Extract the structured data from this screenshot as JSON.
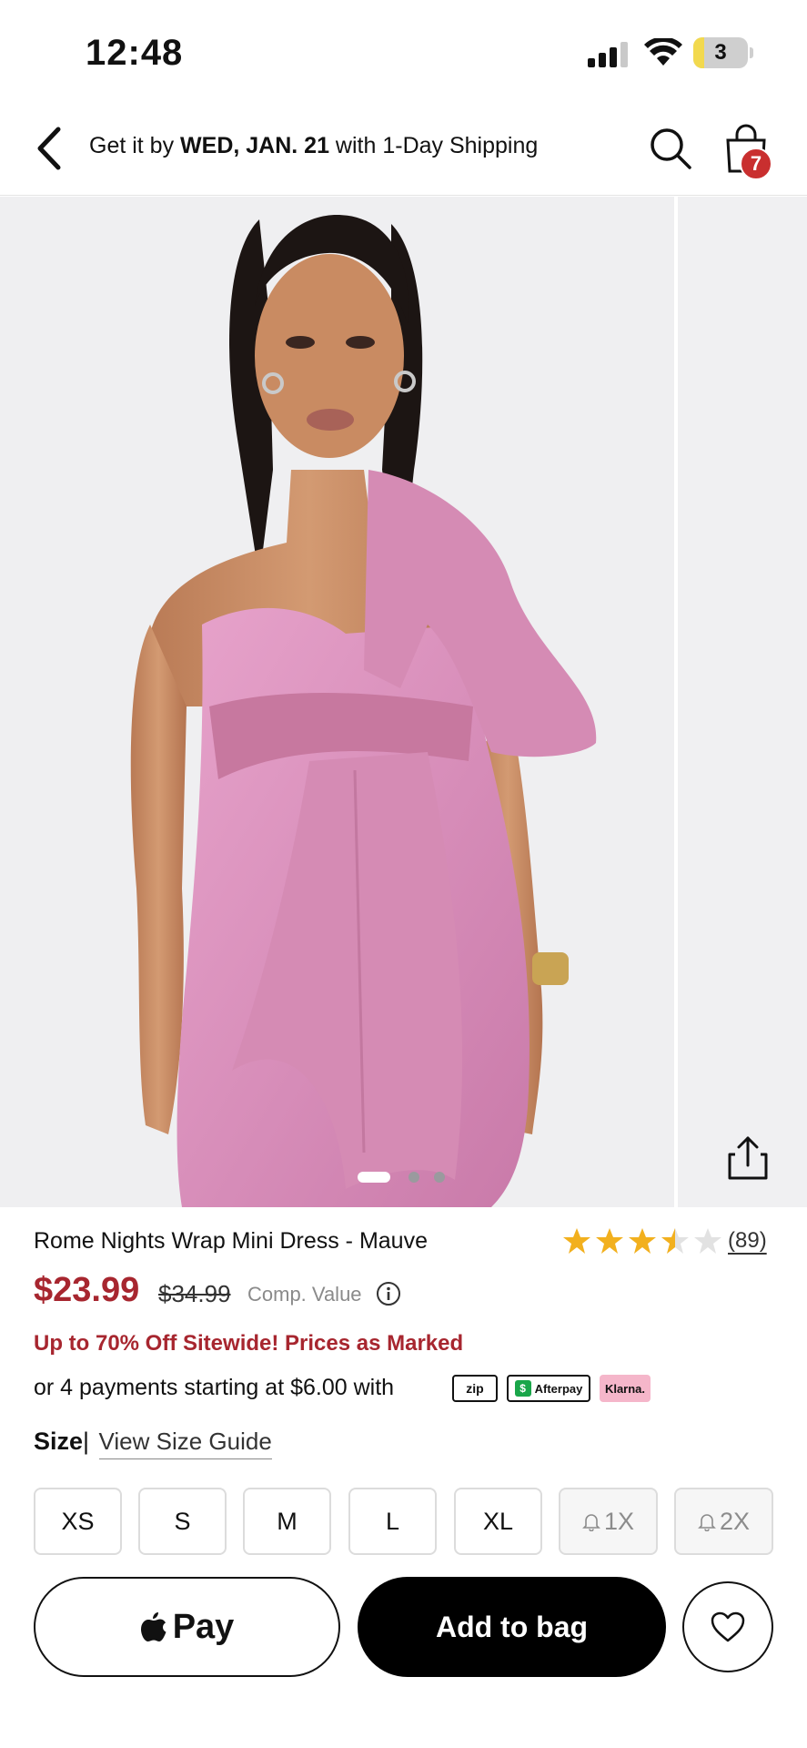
{
  "status_bar": {
    "time": "12:48",
    "battery_level": "3",
    "icons": [
      "cellular-signal-icon",
      "wifi-icon",
      "battery-icon"
    ]
  },
  "header": {
    "shipping_prefix": "Get it by ",
    "shipping_date": "WED, JAN. 21",
    "shipping_suffix": " with 1-Day Shipping",
    "cart_count": "7",
    "icons": [
      "back-arrow-icon",
      "search-icon",
      "shopping-bag-icon"
    ]
  },
  "gallery": {
    "image_count": 3,
    "current_index": 0,
    "share_icon": "share-icon"
  },
  "product": {
    "name": "Rome Nights Wrap Mini Dress - Mauve",
    "rating": 3.5,
    "rating_max": 5,
    "review_count": "(89)",
    "sale_price": "$23.99",
    "original_price": "$34.99",
    "comp_value_label": "Comp. Value",
    "promo": "Up to 70% Off Sitewide! Prices as Marked",
    "payments_text": "or 4 payments starting at $6.00 with",
    "pay_providers": {
      "zip": "zip",
      "afterpay": "Afterpay",
      "klarna": "Klarna."
    }
  },
  "size": {
    "label": "Size",
    "separator": "|",
    "guide_link": "View Size Guide",
    "options": [
      {
        "label": "XS",
        "available": true
      },
      {
        "label": "S",
        "available": true
      },
      {
        "label": "M",
        "available": true
      },
      {
        "label": "L",
        "available": true
      },
      {
        "label": "XL",
        "available": true
      },
      {
        "label": "1X",
        "available": false
      },
      {
        "label": "2X",
        "available": false
      }
    ]
  },
  "actions": {
    "apple_pay_label": "Pay",
    "add_to_bag_label": "Add to bag"
  },
  "colors": {
    "sale_red": "#a7262f",
    "badge_red": "#c92f2f",
    "star_gold": "#f2b01e",
    "dress_mauve": "#d98bb7"
  }
}
